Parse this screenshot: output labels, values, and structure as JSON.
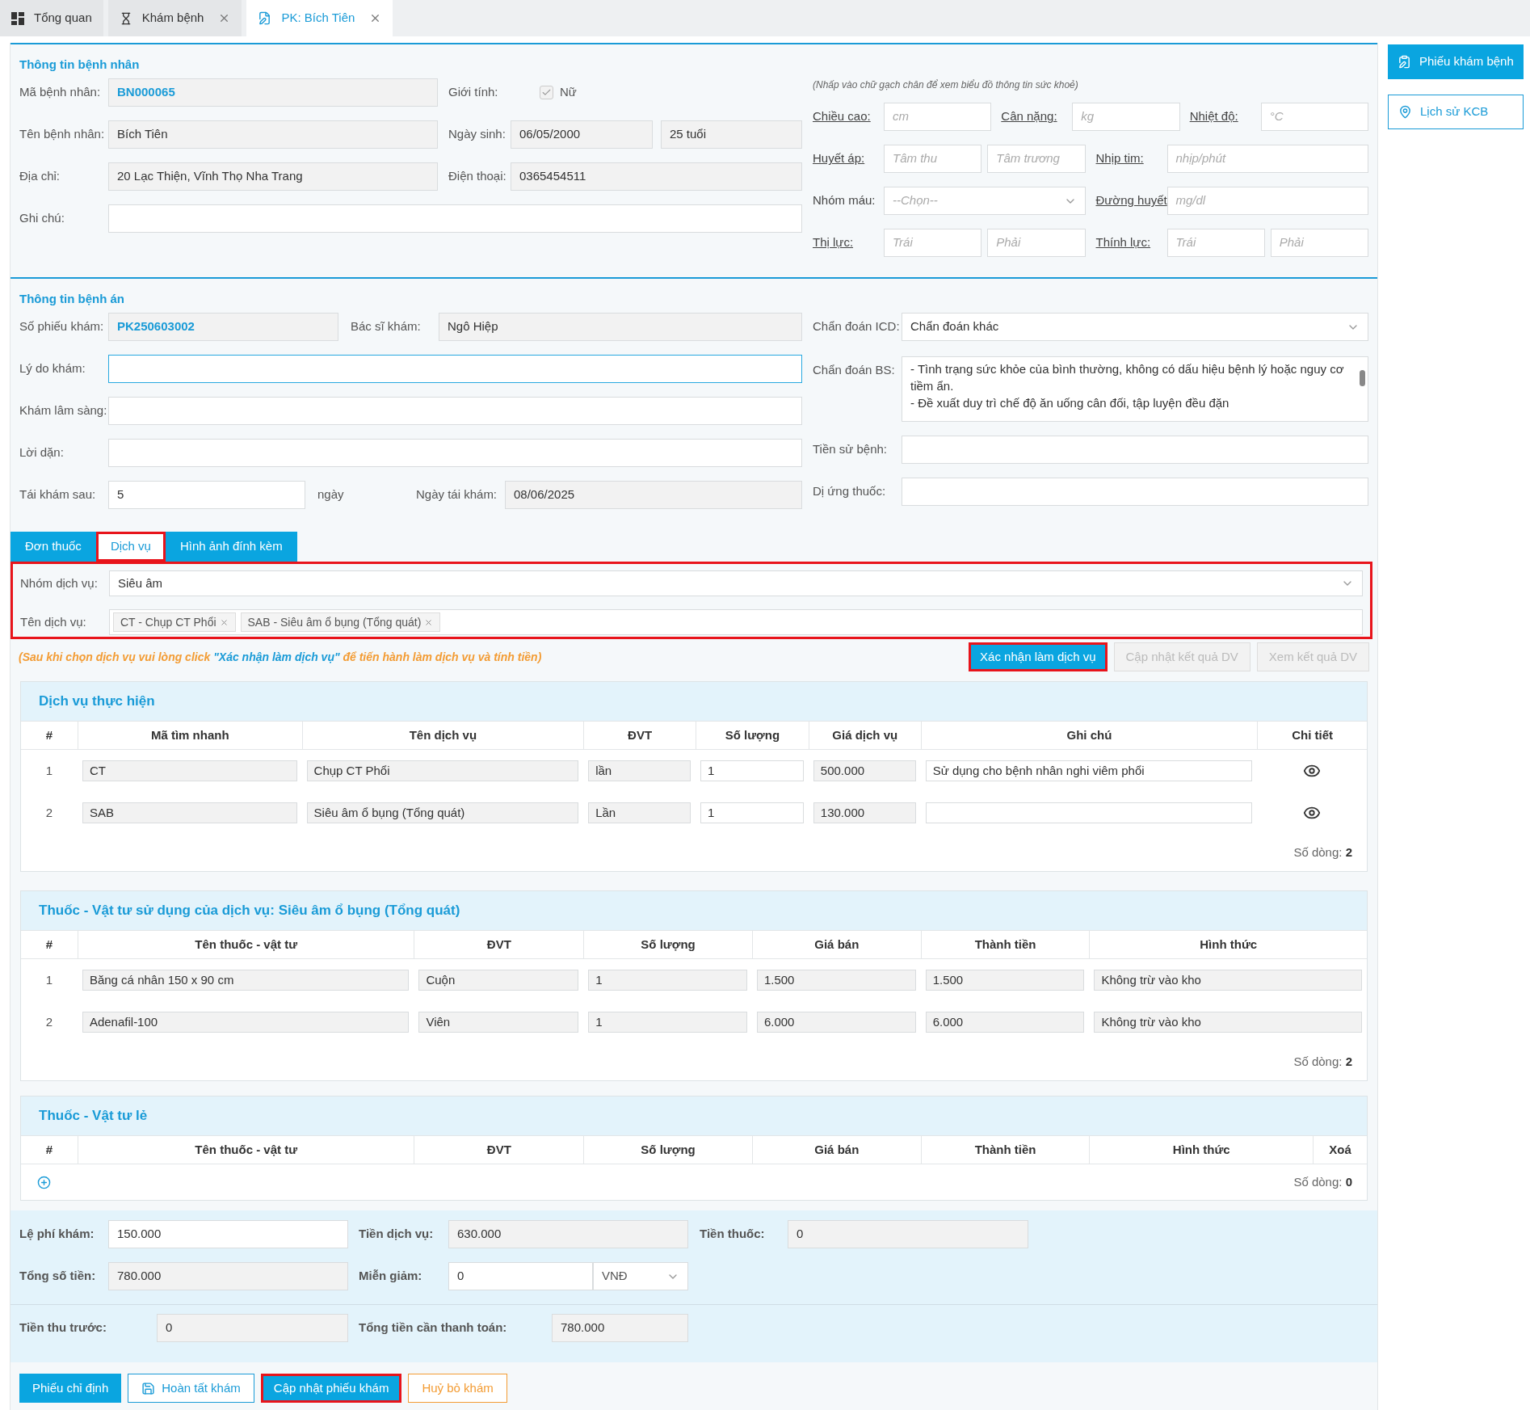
{
  "tabs": [
    {
      "label": "Tổng quan",
      "closable": false,
      "selected": false
    },
    {
      "label": "Khám bệnh",
      "closable": true,
      "selected": false
    },
    {
      "label": "PK: Bích Tiên",
      "closable": true,
      "selected": true
    }
  ],
  "side_actions": [
    {
      "label": "Phiếu khám bệnh",
      "kind": "primary"
    },
    {
      "label": "Lịch sử KCB",
      "kind": "outline"
    }
  ],
  "patient": {
    "title": "Thông tin bệnh nhân",
    "code": {
      "label": "Mã bệnh nhân:",
      "value": "BN000065",
      "kind": "readonly",
      "accent": true
    },
    "gender": {
      "label": "Giới tính:",
      "option": "Nữ",
      "checked": true
    },
    "name": {
      "label": "Tên bệnh nhân:",
      "value": "Bích Tiên",
      "kind": "readonly"
    },
    "dob": {
      "label": "Ngày sinh:",
      "value": "06/05/2000",
      "kind": "readonly"
    },
    "age": {
      "value": "25 tuổi",
      "kind": "readonly"
    },
    "address": {
      "label": "Địa chỉ:",
      "value": "20 Lạc Thiện, Vĩnh Thọ Nha Trang",
      "kind": "readonly"
    },
    "phone": {
      "label": "Điện thoại:",
      "value": "0365454511",
      "kind": "readonly"
    },
    "note": {
      "label": "Ghi chú:",
      "kind": "input"
    }
  },
  "vitals": {
    "hint": "(Nhấp vào chữ gạch chân để xem biểu đồ thông tin sức khoẻ)",
    "rows": [
      {
        "groups": [
          {
            "label": "Chiều cao:",
            "underlined": true,
            "fields": [
              {
                "kind": "input",
                "placeholder": "cm"
              }
            ]
          },
          {
            "label": "Cân nặng:",
            "underlined": true,
            "fields": [
              {
                "kind": "input",
                "placeholder": "kg"
              }
            ]
          },
          {
            "label": "Nhiệt độ:",
            "underlined": true,
            "fields": [
              {
                "kind": "input",
                "placeholder": "°C"
              }
            ]
          }
        ]
      },
      {
        "groups": [
          {
            "label": "Huyết áp:",
            "underlined": true,
            "fields": [
              {
                "kind": "input",
                "placeholder": "Tâm thu"
              },
              {
                "kind": "input",
                "placeholder": "Tâm trương"
              }
            ]
          },
          {
            "label": "Nhịp tim:",
            "underlined": true,
            "fields": [
              {
                "kind": "input",
                "placeholder": "nhịp/phút"
              }
            ]
          }
        ]
      },
      {
        "groups": [
          {
            "label": "Nhóm máu:",
            "underlined": false,
            "fields": [
              {
                "kind": "select",
                "placeholder": "--Chọn--"
              }
            ]
          },
          {
            "label": "Đường huyết",
            "underlined": true,
            "fields": [
              {
                "kind": "input",
                "placeholder": "mg/dl"
              }
            ]
          }
        ]
      },
      {
        "groups": [
          {
            "label": "Thị lực:",
            "underlined": true,
            "fields": [
              {
                "kind": "input",
                "placeholder": "Trái"
              },
              {
                "kind": "input",
                "placeholder": "Phải"
              }
            ]
          },
          {
            "label": "Thính lực:",
            "underlined": true,
            "fields": [
              {
                "kind": "input",
                "placeholder": "Trái"
              },
              {
                "kind": "input",
                "placeholder": "Phải"
              }
            ]
          }
        ]
      }
    ]
  },
  "record": {
    "title": "Thông tin bệnh án",
    "ticket": {
      "label": "Số phiếu khám:",
      "value": "PK250603002",
      "kind": "readonly",
      "accent": true
    },
    "doctor": {
      "label": "Bác sĩ khám:",
      "value": "Ngô Hiệp",
      "kind": "readonly"
    },
    "reason": {
      "label": "Lý do khám:",
      "kind": "input",
      "focused": true
    },
    "clinical": {
      "label": "Khám lâm sàng:",
      "kind": "input",
      "focused": false
    },
    "advice": {
      "label": "Lời dặn:",
      "kind": "input",
      "focused": false
    },
    "revisit": {
      "label": "Tái khám sau:",
      "value": "5",
      "kind": "input",
      "unit": "ngày"
    },
    "revisit_date": {
      "label": "Ngày tái khám:",
      "value": "08/06/2025",
      "kind": "readonly"
    },
    "icd": {
      "label": "Chẩn đoán ICD:",
      "value": "Chẩn đoán khác",
      "kind": "select"
    },
    "diagnosis": {
      "label": "Chẩn đoán BS:",
      "lines": [
        "- Tình trạng sức khỏe của bình thường, không có dấu hiệu bệnh lý hoặc nguy cơ tiềm ẩn.",
        "- Đề xuất duy trì chế độ ăn uống cân đối, tập luyện đều đặn"
      ]
    },
    "history": {
      "label": "Tiền sử bệnh:",
      "kind": "input"
    },
    "allergy": {
      "label": "Dị ứng thuốc:",
      "kind": "input"
    }
  },
  "subtabs": [
    {
      "label": "Đơn thuốc",
      "selected": false,
      "highlighted": false
    },
    {
      "label": "Dịch vụ",
      "selected": true,
      "highlighted": true
    },
    {
      "label": "Hình ảnh đính kèm",
      "selected": false,
      "highlighted": false
    }
  ],
  "services": {
    "highlighted": true,
    "group": {
      "label": "Nhóm dịch vụ:",
      "value": "Siêu âm",
      "kind": "select"
    },
    "names": {
      "label": "Tên dịch vụ:",
      "tags": [
        "CT - Chụp CT Phổi",
        "SAB - Siêu âm ổ bụng (Tổng quát)"
      ]
    }
  },
  "note": {
    "before": "(Sau khi chọn dịch vụ vui lòng click ",
    "quoted": "\"Xác nhận làm dịch vụ\"",
    "after": " để tiến hành làm dịch vụ và tính tiền)"
  },
  "service_actions": [
    {
      "label": "Xác nhận làm dịch vụ",
      "disabled": false,
      "highlighted": true
    },
    {
      "label": "Cập nhật kết quả DV",
      "disabled": true,
      "highlighted": false
    },
    {
      "label": "Xem kết quả DV",
      "disabled": true,
      "highlighted": false
    }
  ],
  "services_table": {
    "title": "Dịch vụ thực hiện",
    "columns": [
      "#",
      "Mã tìm nhanh",
      "Tên dịch vụ",
      "ĐVT",
      "Số lượng",
      "Giá dịch vụ",
      "Ghi chú",
      "Chi tiết"
    ],
    "rows": [
      {
        "cells": [
          {
            "kind": "index",
            "value": "1"
          },
          {
            "kind": "readonly",
            "value": "CT"
          },
          {
            "kind": "readonly",
            "value": "Chụp CT Phổi"
          },
          {
            "kind": "readonly",
            "value": "lần"
          },
          {
            "kind": "input",
            "value": "1"
          },
          {
            "kind": "readonly",
            "value": "500.000"
          },
          {
            "kind": "input",
            "value": "Sử dụng cho bệnh nhân nghi viêm phổi"
          },
          {
            "kind": "view"
          }
        ]
      },
      {
        "cells": [
          {
            "kind": "index",
            "value": "2"
          },
          {
            "kind": "readonly",
            "value": "SAB"
          },
          {
            "kind": "readonly",
            "value": "Siêu âm ổ bụng (Tổng quát)"
          },
          {
            "kind": "readonly",
            "value": "Lần"
          },
          {
            "kind": "input",
            "value": "1"
          },
          {
            "kind": "readonly",
            "value": "130.000"
          },
          {
            "kind": "input"
          },
          {
            "kind": "view"
          }
        ]
      }
    ],
    "count_label": "Số dòng:",
    "count": "2"
  },
  "supplies_table": {
    "title": "Thuốc - Vật tư sử dụng của dịch vụ: Siêu âm ổ bụng (Tổng quát)",
    "columns": [
      "#",
      "Tên thuốc - vật tư",
      "ĐVT",
      "Số lượng",
      "Giá bán",
      "Thành tiền",
      "Hình thức"
    ],
    "rows": [
      {
        "cells": [
          {
            "kind": "index",
            "value": "1"
          },
          {
            "kind": "readonly",
            "value": "Băng cá nhân 150 x 90 cm"
          },
          {
            "kind": "readonly",
            "value": "Cuộn"
          },
          {
            "kind": "readonly",
            "value": "1"
          },
          {
            "kind": "readonly",
            "value": "1.500"
          },
          {
            "kind": "readonly",
            "value": "1.500"
          },
          {
            "kind": "readonly",
            "value": "Không trừ vào kho"
          }
        ]
      },
      {
        "cells": [
          {
            "kind": "index",
            "value": "2"
          },
          {
            "kind": "readonly",
            "value": "Adenafil-100"
          },
          {
            "kind": "readonly",
            "value": "Viên"
          },
          {
            "kind": "readonly",
            "value": "1"
          },
          {
            "kind": "readonly",
            "value": "6.000"
          },
          {
            "kind": "readonly",
            "value": "6.000"
          },
          {
            "kind": "readonly",
            "value": "Không trừ vào kho"
          }
        ]
      }
    ],
    "count_label": "Số dòng:",
    "count": "2"
  },
  "loose_table": {
    "title": "Thuốc - Vật tư lẻ",
    "columns": [
      "#",
      "Tên thuốc - vật tư",
      "ĐVT",
      "Số lượng",
      "Giá bán",
      "Thành tiền",
      "Hình thức",
      "Xoá"
    ],
    "count_label": "Số dòng:",
    "count": "0"
  },
  "fees": {
    "fee": {
      "label": "Lệ phí khám:",
      "value": "150.000",
      "kind": "input"
    },
    "service_cost": {
      "label": "Tiền dịch vụ:",
      "value": "630.000",
      "kind": "readonly"
    },
    "drug_cost": {
      "label": "Tiền thuốc:",
      "value": "0",
      "kind": "readonly"
    },
    "total": {
      "label": "Tổng số tiền:",
      "value": "780.000",
      "kind": "readonly"
    },
    "discount": {
      "label": "Miễn giảm:",
      "value": "0",
      "kind": "input",
      "currency": "VNĐ"
    }
  },
  "payment": {
    "prepaid": {
      "label": "Tiền thu trước:",
      "value": "0",
      "kind": "readonly"
    },
    "due": {
      "label": "Tổng tiền cần thanh toán:",
      "value": "780.000",
      "kind": "readonly"
    }
  },
  "bottom_actions": [
    {
      "label": "Phiếu chỉ định",
      "kind": "primary",
      "highlighted": false
    },
    {
      "label": "Hoàn tất khám",
      "kind": "outline",
      "highlighted": false
    },
    {
      "label": "Cập nhật phiếu khám",
      "kind": "primary",
      "highlighted": true
    },
    {
      "label": "Huỷ bỏ khám",
      "kind": "warning",
      "highlighted": false
    }
  ]
}
